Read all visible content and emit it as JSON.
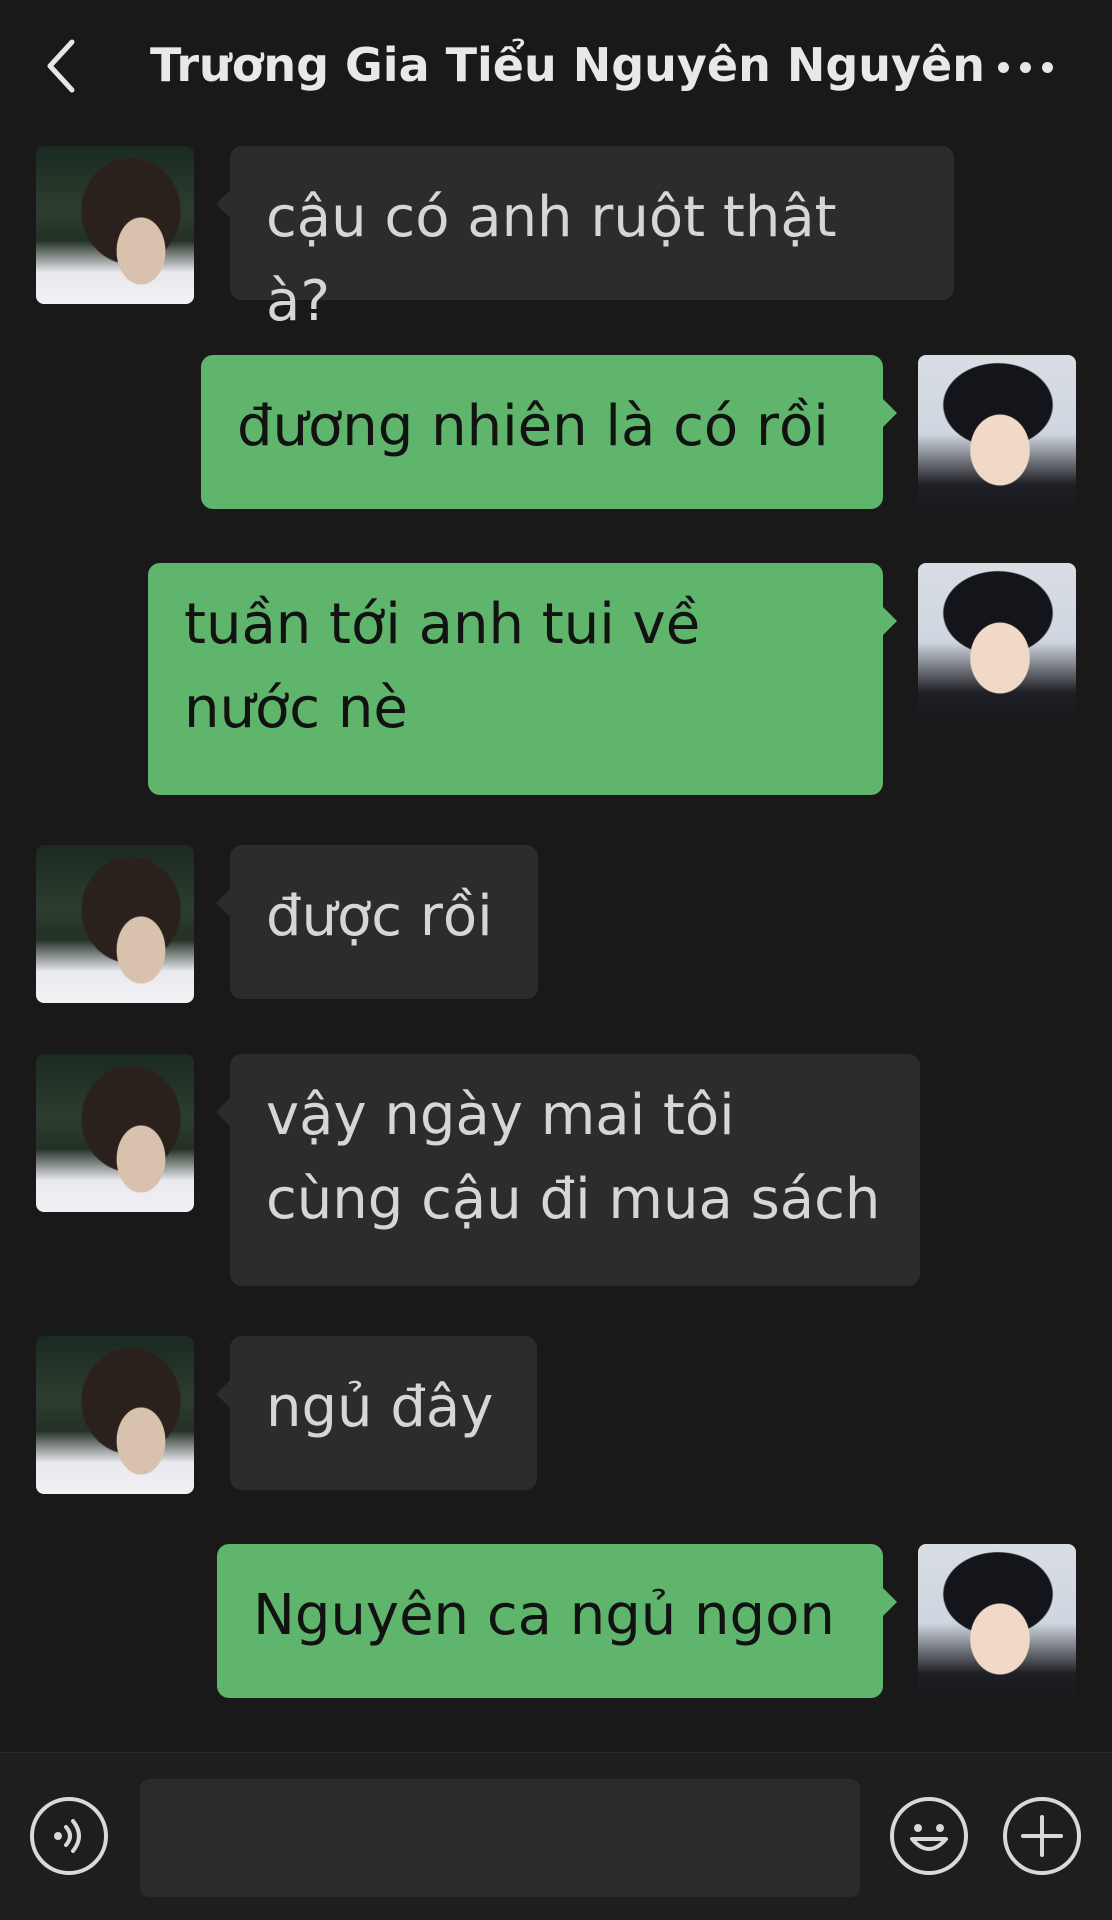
{
  "header": {
    "title": "Trương Gia Tiểu Nguyên Nguyên",
    "back_icon": "chevron-left-icon",
    "more_icon": "more-dots-icon"
  },
  "messages": [
    {
      "side": "in",
      "text": "cậu có anh ruột thật à?"
    },
    {
      "side": "out",
      "text": "đương nhiên là có rồi"
    },
    {
      "side": "out",
      "text": "tuần tới anh tui về nước nè"
    },
    {
      "side": "in",
      "text": "được rồi"
    },
    {
      "side": "in",
      "text": "vậy ngày mai tôi cùng cậu đi mua sách"
    },
    {
      "side": "in",
      "text": "ngủ đây"
    },
    {
      "side": "out",
      "text": "Nguyên ca ngủ ngon"
    }
  ],
  "composer": {
    "voice_icon": "voice-icon",
    "emoji_icon": "emoji-icon",
    "plus_icon": "plus-icon",
    "input_value": ""
  },
  "colors": {
    "background": "#191919",
    "incoming_bubble": "#2c2c2c",
    "outgoing_bubble": "#5eb56b"
  }
}
